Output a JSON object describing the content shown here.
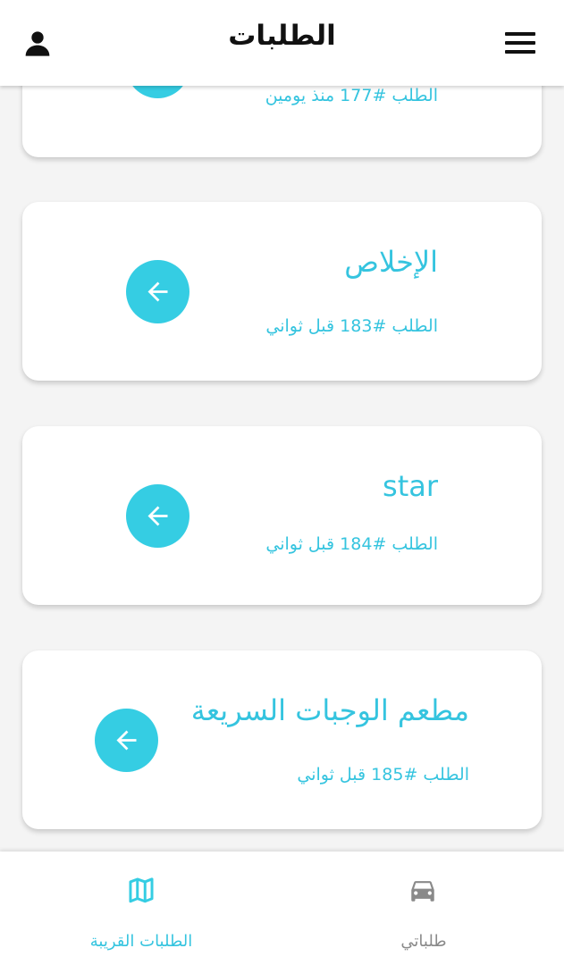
{
  "header": {
    "title": "الطلبات"
  },
  "orders": [
    {
      "name": "",
      "meta": "الطلب #177 منذ يومين"
    },
    {
      "name": "الإخلاص",
      "meta": "الطلب #183 قبل ثواني"
    },
    {
      "name": "star",
      "meta": "الطلب #184 قبل ثواني"
    },
    {
      "name": "مطعم الوجبات السريعة",
      "meta": "الطلب #185 قبل ثواني"
    }
  ],
  "bottom_nav": {
    "items": [
      {
        "label": "الطلبات القريبة",
        "icon": "map-icon",
        "active": true
      },
      {
        "label": "طلباتي",
        "icon": "car-icon",
        "active": false
      }
    ]
  },
  "colors": {
    "accent": "#35cde3",
    "accent_text": "#35c4df",
    "inactive": "#8a8a8a"
  }
}
